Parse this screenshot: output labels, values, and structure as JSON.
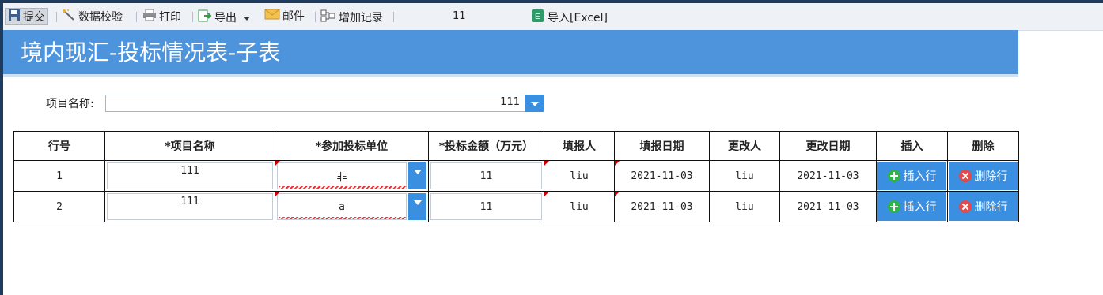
{
  "toolbar": {
    "submit_label": "提交",
    "validate_label": "数据校验",
    "print_label": "打印",
    "export_label": "导出",
    "mail_label": "邮件",
    "add_record_label": "增加记录",
    "record_count": "11",
    "import_label": "导入[Excel]"
  },
  "page": {
    "title": "境内现汇-投标情况表-子表"
  },
  "filter": {
    "project_label": "项目名称:",
    "project_value": "111"
  },
  "table": {
    "headers": [
      "行号",
      "*项目名称",
      "*参加投标单位",
      "*投标金额（万元）",
      "填报人",
      "填报日期",
      "更改人",
      "更改日期",
      "插入",
      "删除"
    ],
    "rows": [
      {
        "no": "1",
        "project": "111",
        "unit": "非",
        "amount": "11",
        "filler": "liu",
        "fill_date": "2021-11-03",
        "modifier": "liu",
        "modify_date": "2021-11-03"
      },
      {
        "no": "2",
        "project": "111",
        "unit": "a",
        "amount": "11",
        "filler": "liu",
        "fill_date": "2021-11-03",
        "modifier": "liu",
        "modify_date": "2021-11-03"
      }
    ],
    "insert_label": "插入行",
    "delete_label": "删除行"
  },
  "icons": {
    "submit": "save-icon",
    "validate": "wand-icon",
    "print": "printer-icon",
    "export": "export-icon",
    "mail": "envelope-icon",
    "add_record": "add-record-icon",
    "import": "excel-icon",
    "insert": "plus-circle-icon",
    "delete": "x-circle-icon"
  },
  "colors": {
    "banner": "#4d94dd",
    "button": "#3b8fe0",
    "insert_icon": "#2fb34a",
    "delete_icon": "#e04a4a"
  }
}
